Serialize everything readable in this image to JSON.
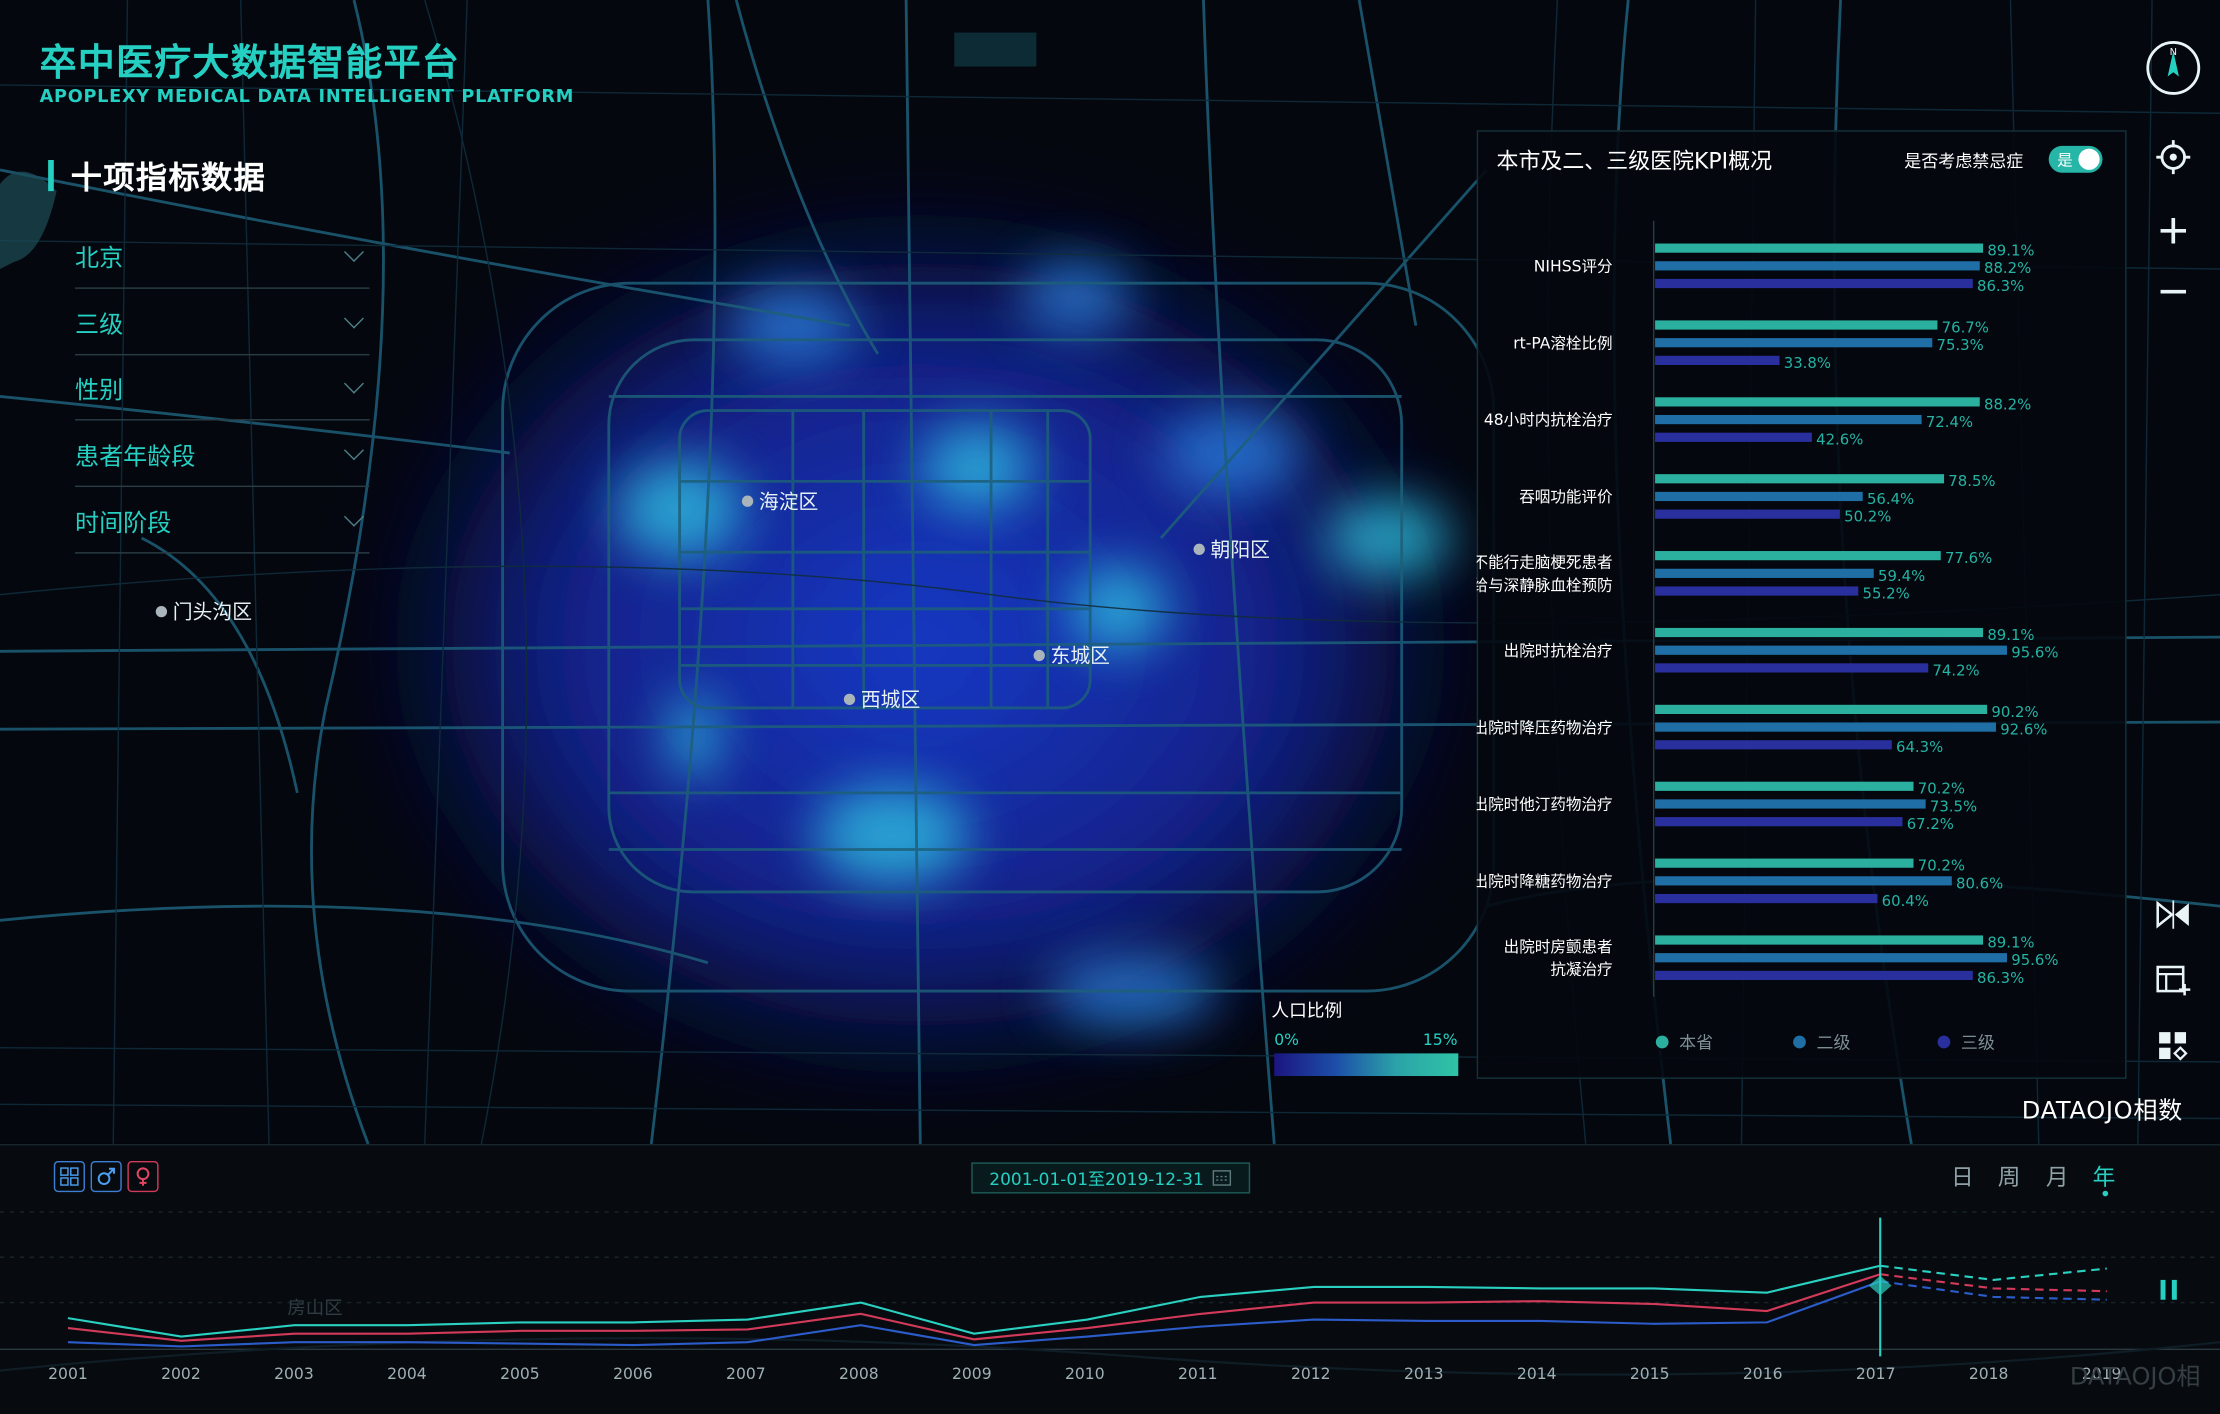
{
  "header": {
    "title_cn": "卒中医疗大数据智能平台",
    "title_en": "APOPLEXY MEDICAL DATA INTELLIGENT PLATFORM"
  },
  "left_panel": {
    "section_title": "十项指标数据",
    "filters": [
      {
        "label": "北京"
      },
      {
        "label": "三级"
      },
      {
        "label": "性别"
      },
      {
        "label": "患者年龄段"
      },
      {
        "label": "时间阶段"
      }
    ]
  },
  "map": {
    "districts": [
      "海淀区",
      "朝阳区",
      "门头沟区",
      "东城区",
      "西城区",
      "房山区"
    ],
    "legend": {
      "title": "人口比例",
      "min": "0%",
      "max": "15%",
      "colors": [
        "#1b1580",
        "#1d4ea8",
        "#2ba3a8",
        "#2fc4a6"
      ]
    }
  },
  "kpi_panel": {
    "title": "本市及二、三级医院KPI概况",
    "toggle_label": "是否考虑禁忌症",
    "toggle_value": "是",
    "toggle_on": true,
    "legend": [
      "本省",
      "二级",
      "三级"
    ],
    "colors": [
      "#2bb09f",
      "#1f6fa6",
      "#2a2f9e"
    ]
  },
  "chart_data": {
    "type": "bar",
    "orientation": "horizontal",
    "categories": [
      [
        "NIHSS评分"
      ],
      [
        "rt-PA溶栓比例"
      ],
      [
        "48小时内抗栓治疗"
      ],
      [
        "吞咽功能评价"
      ],
      [
        "不能行走脑梗死患者",
        "给与深静脉血栓预防"
      ],
      [
        "出院时抗栓治疗"
      ],
      [
        "出院时降压药物治疗"
      ],
      [
        "出院时他汀药物治疗"
      ],
      [
        "出院时降糖药物治疗"
      ],
      [
        "出院时房颤患者",
        "抗凝治疗"
      ]
    ],
    "series": [
      {
        "name": "本省",
        "values": [
          89.1,
          76.7,
          88.2,
          78.5,
          77.6,
          89.1,
          90.2,
          70.2,
          70.2,
          89.1
        ]
      },
      {
        "name": "二级",
        "values": [
          88.2,
          75.3,
          72.4,
          56.4,
          59.4,
          95.6,
          92.6,
          73.5,
          80.6,
          95.6
        ]
      },
      {
        "name": "三级",
        "values": [
          86.3,
          33.8,
          42.6,
          50.2,
          55.2,
          74.2,
          64.3,
          67.2,
          60.4,
          86.3
        ]
      }
    ],
    "unit": "%"
  },
  "toolbar": {
    "compass": "N",
    "tools": [
      "locate-icon",
      "zoom-in-icon",
      "zoom-out-icon",
      "compare-icon",
      "table-add-icon",
      "layout-grid-icon"
    ]
  },
  "brand": {
    "text": "DATAOJO相数",
    "watermark": "DATAOJO相"
  },
  "timeline": {
    "date_range": "2001-01-01至2019-12-31",
    "periods": [
      "日",
      "周",
      "月",
      "年"
    ],
    "active_period": "年",
    "years": [
      "2001",
      "2002",
      "2003",
      "2004",
      "2005",
      "2006",
      "2007",
      "2008",
      "2009",
      "2010",
      "2011",
      "2012",
      "2013",
      "2014",
      "2015",
      "2016",
      "2017",
      "2018",
      "2019"
    ],
    "current_year": "2017",
    "line_colors": [
      "#2ad0c0",
      "#d23a5a",
      "#2c5cc9"
    ]
  }
}
